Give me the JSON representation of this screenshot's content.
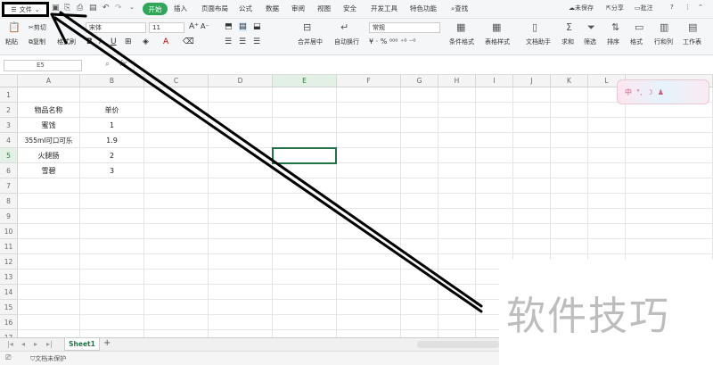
{
  "menubar": {
    "file_label": "文件",
    "tabs": [
      "插入",
      "页面布局",
      "公式",
      "数据",
      "审阅",
      "视图",
      "安全",
      "开发工具",
      "特色功能"
    ],
    "active_tab": "开始",
    "search_label": "查找",
    "unsaved_label": "未保存",
    "share_label": "分享",
    "comment_label": "批注"
  },
  "ribbon": {
    "paste_label": "粘贴",
    "cut_label": "剪切",
    "copy_label": "复制",
    "format_painter_label": "格式刷",
    "font_name": "宋体",
    "font_size": "11",
    "number_format": "常规",
    "merge_label": "合并居中",
    "wrap_label": "自动换行",
    "cond_format_label": "条件格式",
    "table_style_label": "表格样式",
    "doc_helper_label": "文档助手",
    "sum_label": "求和",
    "filter_label": "筛选",
    "sort_label": "排序",
    "format_label": "格式",
    "rowcol_label": "行和列",
    "worksheet_label": "工作表"
  },
  "formula_bar": {
    "cell_ref": "E5"
  },
  "columns": [
    "A",
    "B",
    "C",
    "D",
    "E",
    "F",
    "G",
    "H",
    "I",
    "J",
    "K",
    "L"
  ],
  "rows": [
    "1",
    "2",
    "3",
    "4",
    "5",
    "6",
    "7",
    "8",
    "9",
    "10",
    "11",
    "12",
    "13",
    "14",
    "15",
    "16",
    "17"
  ],
  "table": {
    "header": {
      "a": "物品名称",
      "b": "单价"
    },
    "items": [
      {
        "a": "蜜饯",
        "b": "1"
      },
      {
        "a": "355ml可口可乐",
        "b": "1.9"
      },
      {
        "a": "火腿肠",
        "b": "2"
      },
      {
        "a": "雪碧",
        "b": "3"
      }
    ]
  },
  "sheets": {
    "active": "Sheet1",
    "add_label": "+"
  },
  "status": {
    "protect_label": "文档未保护"
  },
  "ime": {
    "mode": "中"
  },
  "watermark": "软件技巧"
}
